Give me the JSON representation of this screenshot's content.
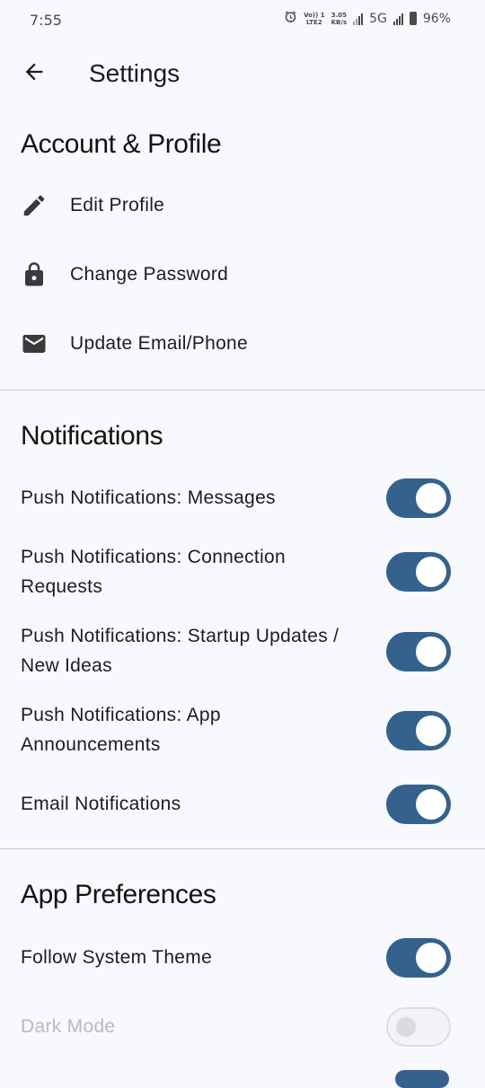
{
  "status_bar": {
    "time": "7:55",
    "volte_top": "Vo)) 1",
    "volte_bottom": "LTE2",
    "speed_top": "3.05",
    "speed_bottom": "KB/s",
    "network": "5G",
    "battery": "96%",
    "icons": [
      "alarm-icon",
      "signal-icon",
      "battery-icon"
    ]
  },
  "app_bar": {
    "title": "Settings",
    "back_icon": "arrow-back-icon"
  },
  "sections": {
    "account": {
      "title": "Account & Profile",
      "items": [
        {
          "label": "Edit Profile",
          "icon": "pencil-icon"
        },
        {
          "label": "Change Password",
          "icon": "lock-icon"
        },
        {
          "label": "Update Email/Phone",
          "icon": "mail-icon"
        }
      ]
    },
    "notifications": {
      "title": "Notifications",
      "toggles": [
        {
          "label": "Push Notifications: Messages",
          "on": true
        },
        {
          "label": "Push Notifications: Connection Requests",
          "on": true
        },
        {
          "label": "Push Notifications: Startup Updates / New Ideas",
          "on": true
        },
        {
          "label": "Push Notifications: App Announcements",
          "on": true
        },
        {
          "label": "Email Notifications",
          "on": true
        }
      ]
    },
    "preferences": {
      "title": "App Preferences",
      "toggles": [
        {
          "label": "Follow System Theme",
          "on": true
        },
        {
          "label": "Dark Mode",
          "on": false,
          "disabled": true
        }
      ]
    }
  },
  "colors": {
    "background": "#f7f9fc",
    "switch_on": "#35618f",
    "switch_off_track": "#f1f3f6",
    "disabled_text": "#b8babd",
    "divider": "#c7c9cc"
  }
}
